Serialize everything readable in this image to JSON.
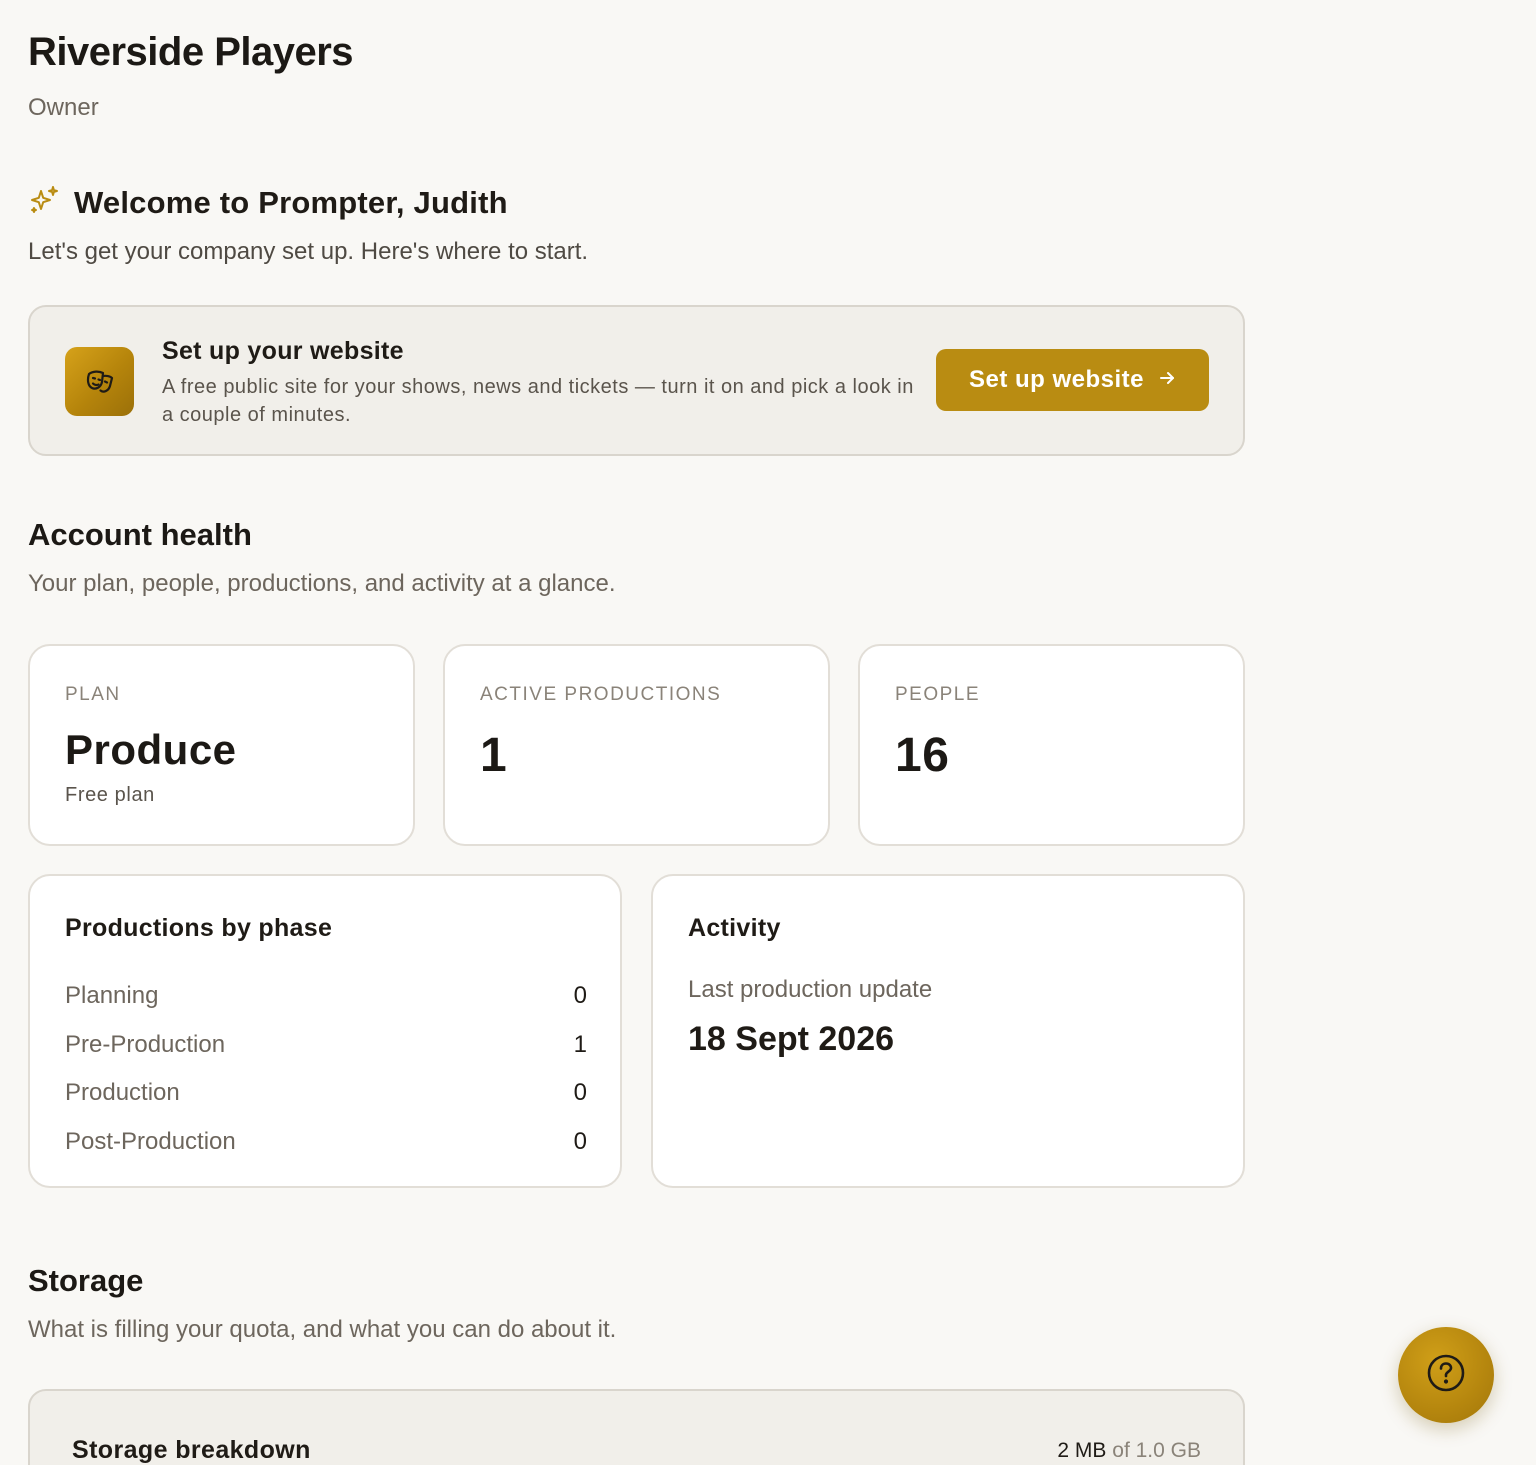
{
  "header": {
    "company_name": "Riverside Players",
    "role": "Owner"
  },
  "welcome": {
    "icon": "sparkles-icon",
    "title": "Welcome to Prompter, Judith",
    "subtitle": "Let's get your company set up. Here's where to start."
  },
  "website_card": {
    "icon": "theater-masks-icon",
    "title": "Set up your website",
    "description": "A free public site for your shows, news and tickets — turn it on and pick a look in a couple of minutes.",
    "button_label": "Set up website",
    "button_icon": "arrow-right-icon",
    "accent_color": "#b98c12"
  },
  "account_health": {
    "title": "Account health",
    "subtitle": "Your plan, people, productions, and activity at a glance.",
    "stats": [
      {
        "label": "PLAN",
        "value": "Produce",
        "sub": "Free plan"
      },
      {
        "label": "ACTIVE PRODUCTIONS",
        "value": "1"
      },
      {
        "label": "PEOPLE",
        "value": "16"
      }
    ],
    "phases": {
      "title": "Productions by phase",
      "rows": [
        {
          "name": "Planning",
          "count": "0"
        },
        {
          "name": "Pre-Production",
          "count": "1"
        },
        {
          "name": "Production",
          "count": "0"
        },
        {
          "name": "Post-Production",
          "count": "0"
        }
      ]
    },
    "activity": {
      "title": "Activity",
      "label": "Last production update",
      "value": "18 Sept 2026"
    }
  },
  "storage": {
    "title": "Storage",
    "subtitle": "What is filling your quota, and what you can do about it.",
    "breakdown_title": "Storage breakdown",
    "used": "2 MB",
    "of_label": "of",
    "quota": "1.0 GB"
  },
  "help": {
    "icon": "help-circle-icon"
  }
}
